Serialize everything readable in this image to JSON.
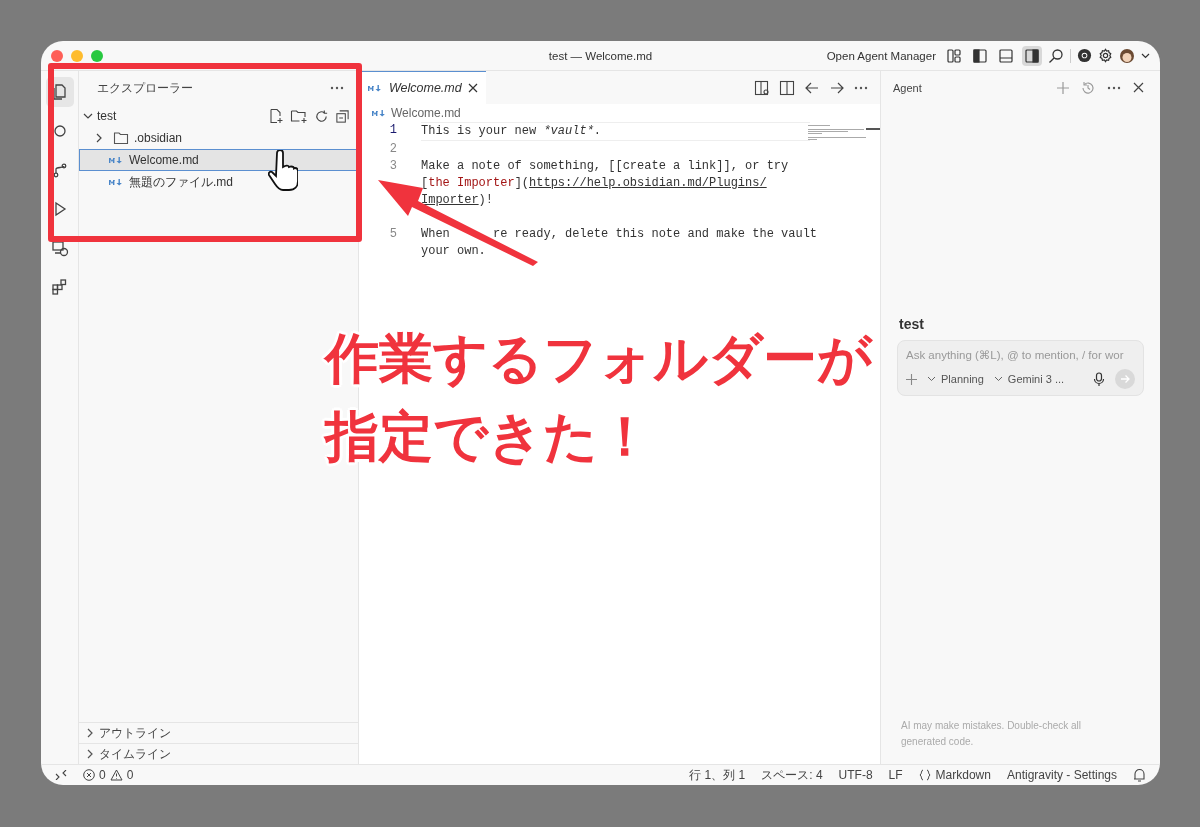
{
  "title_bar": {
    "title": "test — Welcome.md",
    "agent_manager": "Open Agent Manager",
    "layout_toggles": [
      {
        "kind": "customize",
        "selected": false
      },
      {
        "kind": "primary",
        "selected": false
      },
      {
        "kind": "panel",
        "selected": false
      },
      {
        "kind": "secondary",
        "selected": true
      }
    ]
  },
  "activity_bar": [
    {
      "kind": "files",
      "selected": true
    },
    {
      "kind": "search",
      "selected": false
    },
    {
      "kind": "source-control",
      "selected": false
    },
    {
      "kind": "run",
      "selected": false
    },
    {
      "kind": "remote",
      "selected": false
    },
    {
      "kind": "extensions",
      "selected": false
    }
  ],
  "explorer": {
    "title": "エクスプローラー",
    "root": {
      "label": "test",
      "expanded": true,
      "children": [
        {
          "label": ".obsidian",
          "kind": "folder",
          "selected": false
        },
        {
          "label": "Welcome.md",
          "kind": "file",
          "selected": true
        },
        {
          "label": "無題のファイル.md",
          "kind": "file",
          "selected": false
        }
      ]
    },
    "panels": [
      {
        "label": "アウトライン",
        "expanded": false
      },
      {
        "label": "タイムライン",
        "expanded": false
      }
    ]
  },
  "editor": {
    "tabs": [
      {
        "label": "Welcome.md",
        "selected": true
      }
    ],
    "breadcrumb": "Welcome.md",
    "lines": [
      {
        "number": "1",
        "current": true,
        "rows": [
          [
            {
              "kind": "plain",
              "text": "This is your new "
            },
            {
              "kind": "italic",
              "text": "*vault*"
            },
            {
              "kind": "plain",
              "text": "."
            }
          ]
        ]
      },
      {
        "number": "2",
        "current": false,
        "rows": [
          []
        ]
      },
      {
        "number": "3",
        "current": false,
        "rows": [
          [
            {
              "kind": "plain",
              "text": "Make a note of something, [[create a link]], or try"
            }
          ],
          [
            {
              "kind": "plain",
              "text": "["
            },
            {
              "kind": "link",
              "text": "the Importer"
            },
            {
              "kind": "plain",
              "text": "]("
            },
            {
              "kind": "url",
              "text": "https://help.obsidian.md/Plugins/"
            }
          ],
          [
            {
              "kind": "url",
              "text": "Importer"
            },
            {
              "kind": "plain",
              "text": ")!"
            }
          ]
        ]
      },
      {
        "rows": [
          []
        ]
      },
      {
        "number": "5",
        "current": false,
        "rows": [
          [
            {
              "kind": "plain",
              "text": "When"
            },
            {
              "kind": "covered"
            },
            {
              "kind": "plain",
              "text": "re ready, delete this note and make the vault"
            }
          ],
          [
            {
              "kind": "plain",
              "text": "your own."
            }
          ]
        ]
      }
    ]
  },
  "agent": {
    "title": "Agent",
    "heading": "test",
    "placeholder": "Ask anything (⌘L), @ to mention, / for wor",
    "mode": "Planning",
    "model": "Gemini 3 ...",
    "disclaimer": "AI may make mistakes. Double-check all generated code."
  },
  "status_bar": {
    "errors": "0",
    "warnings": "0",
    "items": [
      "行 1、列 1",
      "スペース: 4",
      "UTF-8",
      "LF"
    ],
    "language": "Markdown",
    "settings": "Antigravity - Settings"
  },
  "annotation": {
    "caption": [
      "作業するフォルダーが",
      "指定できた！"
    ]
  }
}
